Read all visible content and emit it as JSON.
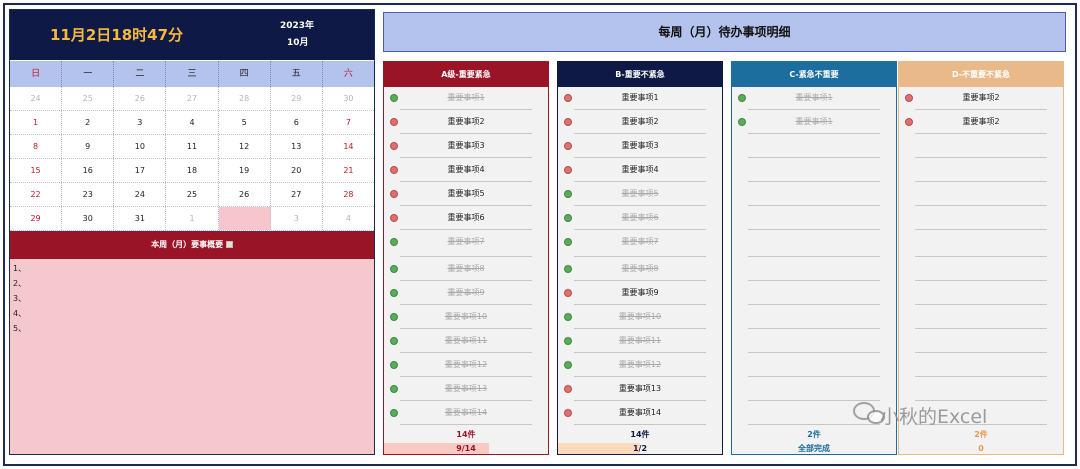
{
  "clock": {
    "time": "11月2日18时47分",
    "year": "2023年",
    "month": "10月"
  },
  "weekdays": [
    "日",
    "一",
    "二",
    "三",
    "四",
    "五",
    "六"
  ],
  "calendar": [
    [
      "24",
      "25",
      "26",
      "27",
      "28",
      "29",
      "30"
    ],
    [
      "1",
      "2",
      "3",
      "4",
      "5",
      "6",
      "7"
    ],
    [
      "8",
      "9",
      "10",
      "11",
      "12",
      "13",
      "14"
    ],
    [
      "15",
      "16",
      "17",
      "18",
      "19",
      "20",
      "21"
    ],
    [
      "22",
      "23",
      "24",
      "25",
      "26",
      "27",
      "28"
    ],
    [
      "29",
      "30",
      "31",
      "1",
      "2",
      "3",
      "4"
    ]
  ],
  "today_marker": "❤",
  "summary": {
    "title": "本周（月）要事概要",
    "lines": [
      "1、",
      "2、",
      "3、",
      "4、",
      "5、"
    ]
  },
  "page_title": "每周（月）待办事项明细",
  "columns": [
    {
      "header": "A级-重要紧急",
      "items": [
        {
          "text": "重要事项1",
          "done": true
        },
        {
          "text": "重要事项2",
          "done": false
        },
        {
          "text": "重要事项3",
          "done": false
        },
        {
          "text": "重要事项4",
          "done": false
        },
        {
          "text": "重要事项5",
          "done": false
        },
        {
          "text": "重要事项6",
          "done": false
        },
        {
          "text": "重要事项7",
          "done": true
        },
        {
          "text": "重要事项8",
          "done": true
        },
        {
          "text": "重要事项9",
          "done": true
        },
        {
          "text": "重要事项10",
          "done": true
        },
        {
          "text": "重要事项11",
          "done": true
        },
        {
          "text": "重要事项12",
          "done": true
        },
        {
          "text": "重要事项13",
          "done": true
        },
        {
          "text": "重要事项14",
          "done": true
        }
      ],
      "count": "14件",
      "progress_label": "9/14",
      "progress_fraction": 0.643
    },
    {
      "header": "B-重要不紧急",
      "items": [
        {
          "text": "重要事项1",
          "done": false
        },
        {
          "text": "重要事项2",
          "done": false
        },
        {
          "text": "重要事项3",
          "done": false
        },
        {
          "text": "重要事项4",
          "done": false
        },
        {
          "text": "重要事项5",
          "done": true
        },
        {
          "text": "重要事项6",
          "done": true
        },
        {
          "text": "重要事项7",
          "done": true
        },
        {
          "text": "重要事项8",
          "done": true
        },
        {
          "text": "重要事项9",
          "done": false
        },
        {
          "text": "重要事项10",
          "done": true
        },
        {
          "text": "重要事项11",
          "done": true
        },
        {
          "text": "重要事项12",
          "done": true
        },
        {
          "text": "重要事项13",
          "done": false
        },
        {
          "text": "重要事项14",
          "done": false
        }
      ],
      "count": "14件",
      "progress_label": "1/2",
      "progress_fraction": 0.5
    },
    {
      "header": "C-紧急不重要",
      "items": [
        {
          "text": "重要事项1",
          "done": true
        },
        {
          "text": "重要事项1",
          "done": true
        }
      ],
      "count": "2件",
      "progress_label": "全部完成",
      "progress_fraction": 1
    },
    {
      "header": "D-不重要不紧急",
      "items": [
        {
          "text": "重要事项2",
          "done": false
        },
        {
          "text": "重要事项2",
          "done": false
        }
      ],
      "count": "2件",
      "progress_label": "0",
      "progress_fraction": 0
    }
  ],
  "watermark": "小秋的Excel"
}
